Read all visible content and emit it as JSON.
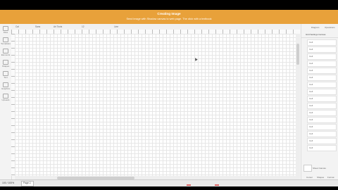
{
  "banner": {
    "title": "Creating Image",
    "message": "Send image with Shadow canvas to web page. The click with a textbook"
  },
  "toolbar": {
    "items": [
      "Cal",
      "Sans",
      "Ari Tools",
      "12",
      "Line"
    ]
  },
  "leftbar": {
    "items": [
      "Files",
      "Templates",
      "Elements",
      "Shapes",
      "Text",
      "Graphics",
      "Uploads"
    ]
  },
  "rightpanel": {
    "tabs": [
      "Diagram",
      "Operations"
    ],
    "heading": "Grid Settings Canvas",
    "cells": [
      "Cell",
      "Cell",
      "Cell",
      "Cell",
      "Cell",
      "Cell",
      "Cell",
      "Cell",
      "Cell",
      "Cell",
      "Cell",
      "Cell",
      "Cell",
      "Cell",
      "Cell",
      "Cell"
    ],
    "swatch_label": "Sheet Canvas",
    "footer": [
      "Cursor",
      "Shapes",
      "Format"
    ]
  },
  "pagebar": {
    "zoom": "100 / 100%",
    "page_tab": "Page-1"
  }
}
